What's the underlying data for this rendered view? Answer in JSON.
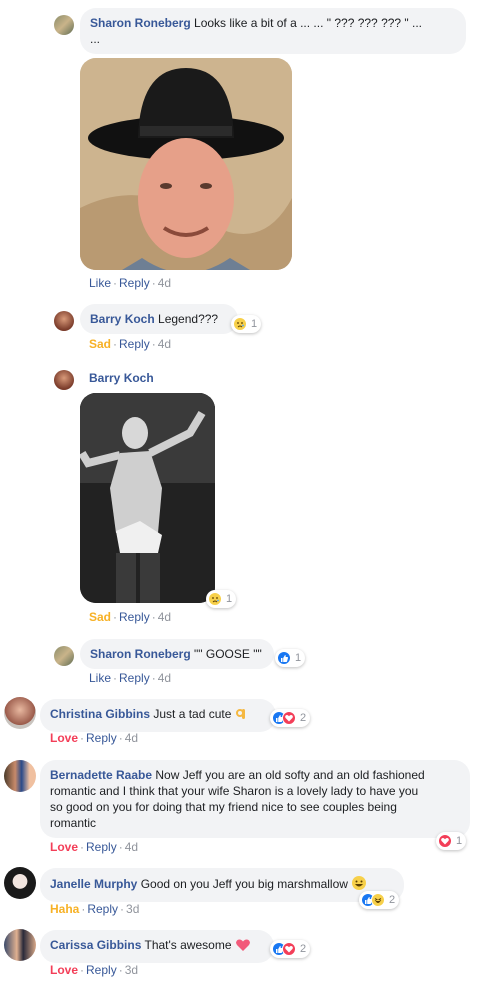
{
  "comments": [
    {
      "id": "c1",
      "author": "Sharon Roneberg",
      "text": "Looks like a bit of a ... ... \" ??? ??? ??? \" ...",
      "text_cont": "...",
      "actions": {
        "like": "Like",
        "reply": "Reply",
        "time": "4d"
      }
    },
    {
      "id": "c2",
      "author": "Barry Koch",
      "text": "Legend???",
      "reaction_count": "1",
      "actions": {
        "reaction": "Sad",
        "reply": "Reply",
        "time": "4d"
      }
    },
    {
      "id": "c3",
      "author": "Barry Koch",
      "reaction_count": "1",
      "actions": {
        "reaction": "Sad",
        "reply": "Reply",
        "time": "4d"
      }
    },
    {
      "id": "c4",
      "author": "Sharon Roneberg",
      "text": "\"\" GOOSE \"\"",
      "reaction_count": "1",
      "actions": {
        "like": "Like",
        "reply": "Reply",
        "time": "4d"
      }
    },
    {
      "id": "c5",
      "author": "Christina Gibbins",
      "text": "Just a tad cute",
      "reaction_count": "2",
      "actions": {
        "reaction": "Love",
        "reply": "Reply",
        "time": "4d"
      }
    },
    {
      "id": "c6",
      "author": "Bernadette Raabe",
      "text": "Now Jeff you are an old softy and an old fashioned",
      "text_lines": [
        "romantic and I think that your wife Sharon is a lovely lady to have you",
        "so good on you for doing that my friend nice to see couples being",
        "romantic"
      ],
      "reaction_count": "1",
      "actions": {
        "reaction": "Love",
        "reply": "Reply",
        "time": "4d"
      }
    },
    {
      "id": "c7",
      "author": "Janelle Murphy",
      "text": "Good on you Jeff you big marshmallow",
      "reaction_count": "2",
      "actions": {
        "reaction": "Haha",
        "reply": "Reply",
        "time": "3d"
      }
    },
    {
      "id": "c8",
      "author": "Carissa Gibbins",
      "text": "That's awesome",
      "reaction_count": "2",
      "actions": {
        "reaction": "Love",
        "reply": "Reply",
        "time": "3d"
      }
    }
  ],
  "colors": {
    "author": "#385898",
    "bubble": "#f2f3f5",
    "love": "#f33e58",
    "sad": "#f7b125",
    "like": "#1877f2"
  }
}
